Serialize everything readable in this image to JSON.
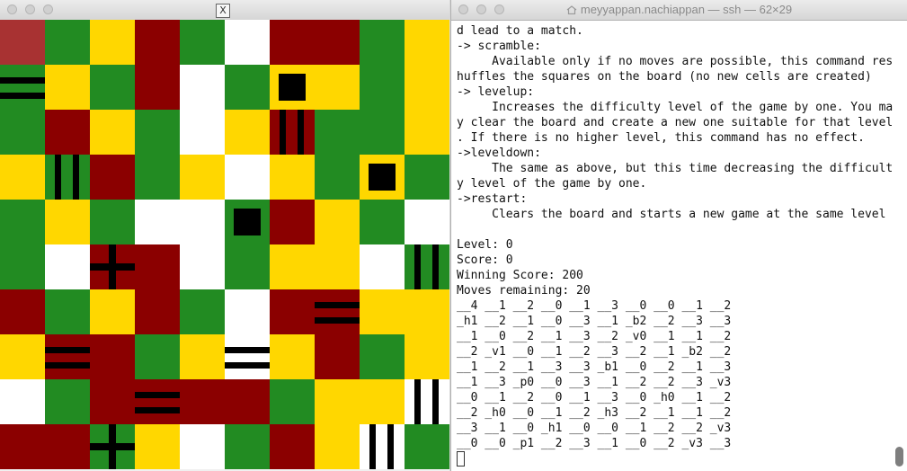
{
  "x_window": {
    "title_icon": "x-logo-icon",
    "title_glyph": "X",
    "board": {
      "rows": [
        [
          "T",
          "G",
          "Y",
          "R",
          "G",
          "W",
          "R",
          "R",
          "G",
          "Y"
        ],
        [
          "G",
          "Y",
          "G",
          "R",
          "W",
          "G",
          "Y",
          "Y",
          "G",
          "Y"
        ],
        [
          "G",
          "R",
          "Y",
          "G",
          "W",
          "Y",
          "R",
          "G",
          "G",
          "Y"
        ],
        [
          "Y",
          "G",
          "R",
          "G",
          "Y",
          "W",
          "Y",
          "G",
          "Y",
          "G"
        ],
        [
          "G",
          "Y",
          "G",
          "W",
          "W",
          "G",
          "R",
          "Y",
          "G",
          "W"
        ],
        [
          "G",
          "W",
          "R",
          "R",
          "W",
          "G",
          "Y",
          "Y",
          "W",
          "G"
        ],
        [
          "R",
          "G",
          "Y",
          "R",
          "G",
          "W",
          "R",
          "R",
          "Y",
          "Y"
        ],
        [
          "Y",
          "R",
          "R",
          "G",
          "Y",
          "W",
          "Y",
          "R",
          "G",
          "Y"
        ],
        [
          "W",
          "G",
          "R",
          "R",
          "R",
          "R",
          "G",
          "Y",
          "Y",
          "W"
        ],
        [
          "R",
          "R",
          "G",
          "Y",
          "W",
          "G",
          "R",
          "Y",
          "W",
          "G"
        ]
      ],
      "specials": [
        {
          "row": 1,
          "col": 0,
          "kind": "h"
        },
        {
          "row": 1,
          "col": 6,
          "kind": "b"
        },
        {
          "row": 2,
          "col": 6,
          "kind": "v"
        },
        {
          "row": 3,
          "col": 1,
          "kind": "v"
        },
        {
          "row": 3,
          "col": 8,
          "kind": "b"
        },
        {
          "row": 4,
          "col": 5,
          "kind": "b"
        },
        {
          "row": 5,
          "col": 2,
          "kind": "p"
        },
        {
          "row": 5,
          "col": 9,
          "kind": "v"
        },
        {
          "row": 6,
          "col": 7,
          "kind": "h"
        },
        {
          "row": 7,
          "col": 1,
          "kind": "h"
        },
        {
          "row": 7,
          "col": 5,
          "kind": "h"
        },
        {
          "row": 8,
          "col": 3,
          "kind": "h"
        },
        {
          "row": 8,
          "col": 9,
          "kind": "v"
        },
        {
          "row": 9,
          "col": 2,
          "kind": "p"
        },
        {
          "row": 9,
          "col": 8,
          "kind": "v"
        }
      ]
    }
  },
  "terminal": {
    "title": "meyyappan.nachiappan — ssh — 62×29",
    "home_icon": "home-icon",
    "lines": [
      "d lead to a match.",
      "-> scramble:",
      "     Available only if no moves are possible, this command res",
      "huffles the squares on the board (no new cells are created)",
      "-> levelup:",
      "     Increases the difficulty level of the game by one. You ma",
      "y clear the board and create a new one suitable for that level",
      ". If there is no higher level, this command has no effect.",
      "->leveldown:",
      "     The same as above, but this time decreasing the difficult",
      "y level of the game by one.",
      "->restart:",
      "     Clears the board and starts a new game at the same level",
      "",
      "Level: 0",
      "Score: 0",
      "Winning Score: 200",
      "Moves remaining: 20",
      "__4 __1 __2 __0 __1 __3 __0 __0 __1 __2",
      "_h1 __2 __1 __0 __3 __1 _b2 __2 __3 __3",
      "__1 __0 __2 __1 __3 __2 _v0 __1 __1 __2",
      "__2 _v1 __0 __1 __2 __3 __2 __1 _b2 __2",
      "__1 __2 __1 __3 __3 _b1 __0 __2 __1 __3",
      "__1 __3 _p0 __0 __3 __1 __2 __2 __3 _v3",
      "__0 __1 __2 __0 __1 __3 __0 _h0 __1 __2",
      "__2 _h0 __0 __1 __2 _h3 __2 __1 __1 __2",
      "__3 __1 __0 _h1 __0 __0 __1 __2 __2 _v3",
      "__0 __0 _p1 __2 __3 __1 __0 __2 _v3 __3"
    ]
  }
}
